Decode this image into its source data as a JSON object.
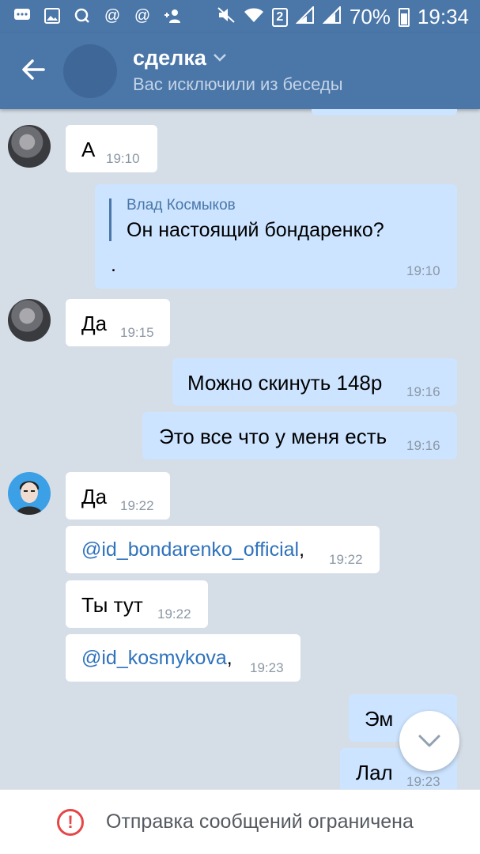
{
  "status_bar": {
    "left_icons": [
      "chat-icon",
      "image-icon",
      "q-icon",
      "at-icon",
      "at-icon",
      "add-person-icon"
    ],
    "sim_badge": "2",
    "battery_percent": "70%",
    "time": "19:34"
  },
  "header": {
    "title": "сделка",
    "subtitle": "Вас исключили из беседы"
  },
  "messages": [
    {
      "text": "А",
      "time": "19:10"
    },
    {
      "reply_author": "Влад Космыков",
      "reply_text": "Он настоящий бондаренко?",
      "text": ".",
      "time": "19:10"
    },
    {
      "text": "Да",
      "time": "19:15"
    },
    {
      "text": "Можно скинуть 148р",
      "time": "19:16"
    },
    {
      "text": "Это все что у меня есть",
      "time": "19:16"
    },
    {
      "text": "Да",
      "time": "19:22"
    },
    {
      "mention": "@id_bondarenko_official",
      "suffix": ",",
      "time": "19:22"
    },
    {
      "text": "Ты тут",
      "time": "19:22"
    },
    {
      "mention": "@id_kosmykova",
      "suffix": ",",
      "time": "19:23"
    },
    {
      "text": "Эм"
    },
    {
      "text": "Лал",
      "time": "19:23"
    }
  ],
  "footer": {
    "text": "Отправка сообщений ограничена"
  }
}
